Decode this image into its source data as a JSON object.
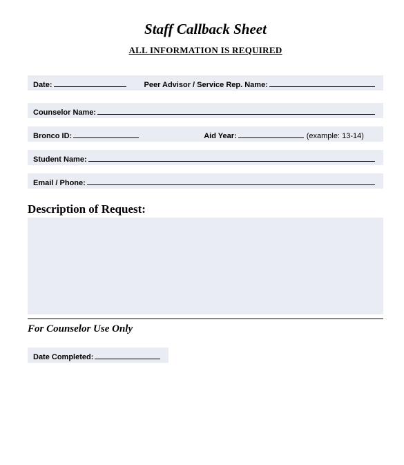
{
  "title": "Staff Callback Sheet",
  "subtitle": "ALL INFORMATION IS REQUIRED",
  "labels": {
    "date": "Date:",
    "peer": "Peer Advisor / Service Rep. Name:",
    "counselor": "Counselor Name:",
    "bronco": "Bronco ID:",
    "aidyear": "Aid Year:",
    "aidyear_example": "(example: 13-14)",
    "student": "Student Name:",
    "email": "Email / Phone:",
    "description": "Description of Request:",
    "counselor_section": "For Counselor Use Only",
    "date_completed": "Date Completed:"
  }
}
